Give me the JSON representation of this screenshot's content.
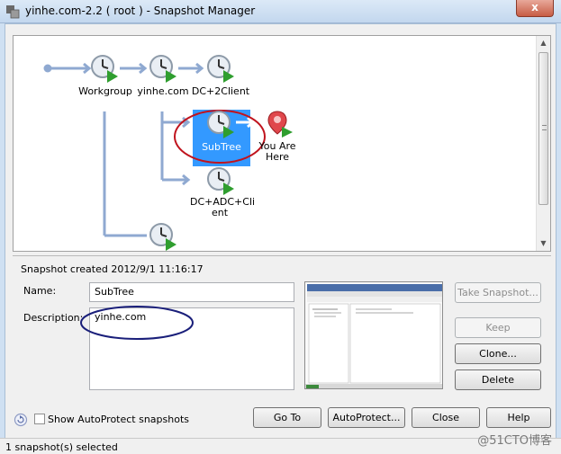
{
  "window": {
    "title": "yinhe.com-2.2 ( root )  - Snapshot Manager",
    "close_symbol": "x"
  },
  "tree": {
    "nodes": [
      {
        "label": "Workgroup"
      },
      {
        "label": "yinhe.com"
      },
      {
        "label": "DC+2Client"
      },
      {
        "label": "SubTree"
      },
      {
        "label": "You Are Here"
      },
      {
        "label": "DC+ADC+Client"
      }
    ],
    "node_label_lines": {
      "you_are_here_1": "You Are",
      "you_are_here_2": "Here",
      "dc_adc_1": "DC+ADC+Cli",
      "dc_adc_2": "ent"
    },
    "selected": "SubTree"
  },
  "details": {
    "created": "Snapshot created 2012/9/1 11:16:17",
    "name_label": "Name:",
    "name_value": "SubTree",
    "description_label": "Description:",
    "description_value": "yinhe.com"
  },
  "buttons": {
    "take_snapshot": "Take Snapshot...",
    "keep": "Keep",
    "clone": "Clone...",
    "delete": "Delete",
    "go_to": "Go To",
    "autoprotect": "AutoProtect...",
    "close": "Close",
    "help": "Help"
  },
  "options": {
    "show_autoprotect_label": "Show AutoProtect snapshots",
    "show_autoprotect_checked": false
  },
  "status": {
    "text": "1 snapshot(s) selected"
  },
  "watermark": "@51CTO博客",
  "colors": {
    "selection": "#3399ff",
    "connector": "#8fa9d1",
    "annotation_red": "#c0141e",
    "annotation_navy": "#1a1f7a"
  }
}
